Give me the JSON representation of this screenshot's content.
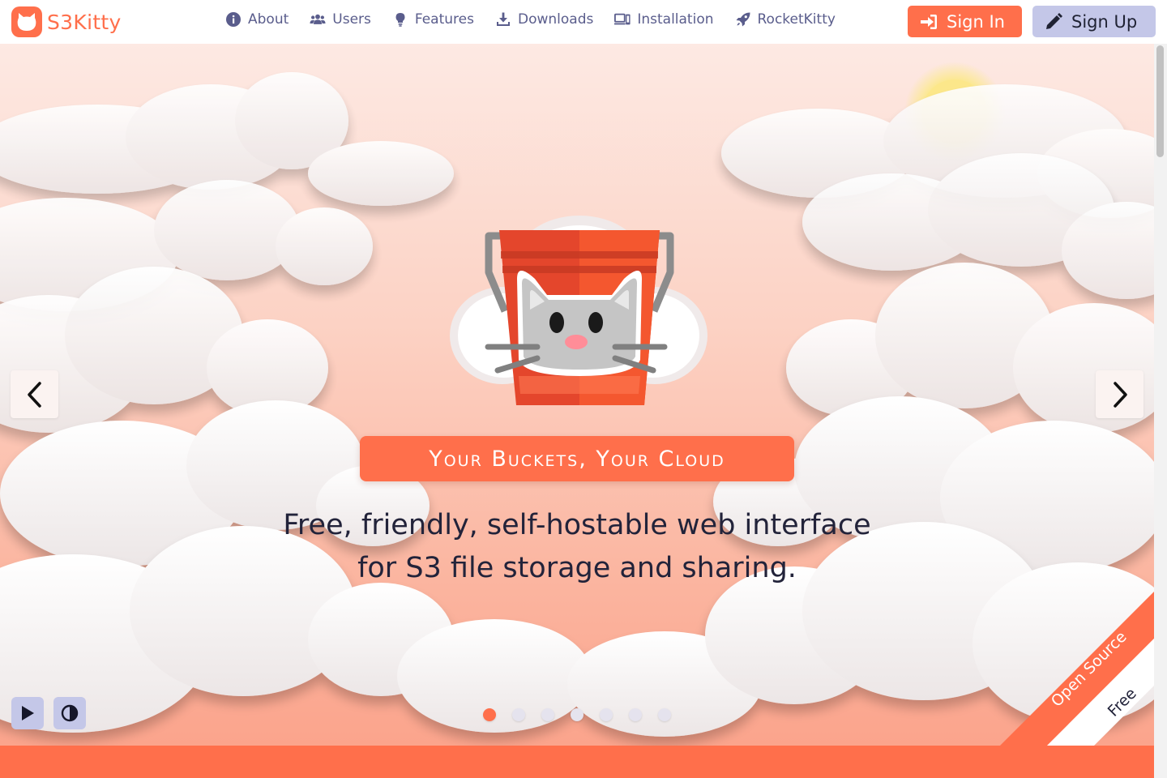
{
  "brand": {
    "name": "S3Kitty",
    "accent": "#ff6f4b",
    "muted": "#c4c7e8",
    "nav_text": "#5a5d8c"
  },
  "nav": {
    "items": [
      {
        "label": "About",
        "icon": "info-icon"
      },
      {
        "label": "Users",
        "icon": "users-icon"
      },
      {
        "label": "Features",
        "icon": "lightbulb-icon"
      },
      {
        "label": "Downloads",
        "icon": "download-icon"
      },
      {
        "label": "Installation",
        "icon": "devices-icon"
      },
      {
        "label": "RocketKitty",
        "icon": "rocket-icon"
      }
    ],
    "sign_in": "Sign In",
    "sign_up": "Sign Up"
  },
  "hero": {
    "tagline": "Your Buckets, Your Cloud",
    "subtitle_line1": "Free, friendly, self-hostable web interface",
    "subtitle_line2": "for S3 file storage and sharing.",
    "slides_total": 7,
    "active_slide": 1
  },
  "ribbon": {
    "top_text": "Open Source",
    "bottom_text": "Free"
  }
}
